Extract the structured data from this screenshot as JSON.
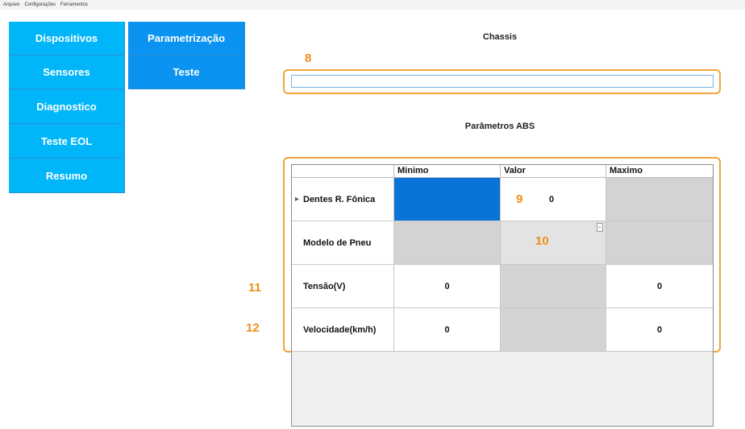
{
  "menubar": {
    "items": [
      "Arquivo",
      "Configurações",
      "Ferramentos"
    ]
  },
  "nav": {
    "left": [
      "Dispositivos",
      "Sensores",
      "Diagnostico",
      "Teste EOL",
      "Resumo"
    ],
    "sub": [
      "Parametrização",
      "Teste"
    ]
  },
  "chassis": {
    "title": "Chassis",
    "value": ""
  },
  "abs": {
    "title": "Parâmetros ABS",
    "columns": [
      "Minimo",
      "Valor",
      "Maximo"
    ],
    "rows": [
      {
        "label": "Dentes R. Fônica",
        "min": "",
        "value": "0",
        "max": ""
      },
      {
        "label": "Modelo de Pneu",
        "min": "",
        "value": "",
        "max": ""
      },
      {
        "label": "Tensão(V)",
        "min": "0",
        "value": "",
        "max": "0"
      },
      {
        "label": "Velocidade(km/h)",
        "min": "0",
        "value": "",
        "max": "0"
      }
    ]
  },
  "callouts": [
    "8",
    "9",
    "10",
    "11",
    "12"
  ],
  "colors": {
    "nav": "#00b6f9",
    "nav_sub": "#0a93f0",
    "selected_cell": "#0a73d7",
    "callout": "#ef8d14"
  }
}
